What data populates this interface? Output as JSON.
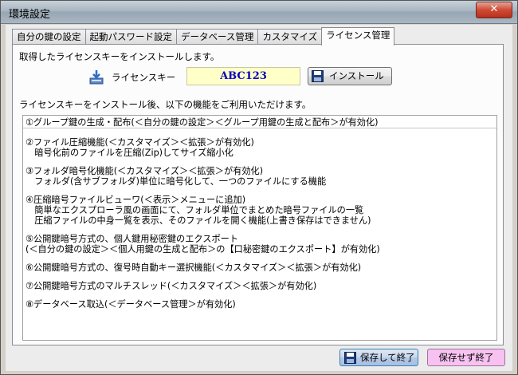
{
  "window": {
    "title": "環境設定",
    "close_glyph": "✕"
  },
  "tabs": [
    {
      "label": "自分の鍵の設定",
      "active": false
    },
    {
      "label": "起動パスワード設定",
      "active": false
    },
    {
      "label": "データベース管理",
      "active": false
    },
    {
      "label": "カスタマイズ",
      "active": false
    },
    {
      "label": "ライセンス管理",
      "active": true
    }
  ],
  "license": {
    "intro": "取得したライセンスキーをインストールします。",
    "key_label": "ライセンスキー",
    "key_value": "ABC123",
    "install_label": "インストール",
    "after_text": "ライセンスキーをインストール後、以下の機能をご利用いただけます。"
  },
  "features": [
    "①グループ鍵の生成・配布(＜自分の鍵の設定＞＜グループ用鍵の生成と配布＞が有効化)",
    "②ファイル圧縮機能(＜カスタマイズ＞＜拡張＞が有効化)\n　暗号化前のファイルを圧縮(Zip)してサイズ縮小化",
    "③フォルダ暗号化機能(＜カスタマイズ＞＜拡張＞が有効化)\n　フォルダ(含サブフォルダ)単位に暗号化して、一つのファイルにする機能",
    "④圧縮暗号ファイルビューワ(＜表示＞メニューに追加)\n　簡単なエクスプローラ風の画面にて、フォルダ単位でまとめた暗号ファイルの一覧\n　圧縮ファイルの中身一覧を表示、そのファイルを開く機能(上書き保存はできません)",
    "⑤公開鍵暗号方式の、個人鍵用秘密鍵のエクスポート\n(＜自分の鍵の設定＞＜個人用鍵の生成と配布＞の【口秘密鍵のエクスポート】が有効化)",
    "⑥公開鍵暗号方式の、復号時自動キー選択機能(＜カスタマイズ＞＜拡張＞が有効化)",
    "⑦公開鍵暗号方式のマルチスレッド(＜カスタマイズ＞＜拡張＞が有効化)",
    "⑧データベース取込(＜データベース管理＞が有効化)"
  ],
  "buttons": {
    "save_exit": "保存して終了",
    "exit_no_save": "保存せず終了"
  },
  "icons": {
    "install": "floppy-icon",
    "license": "install-download-icon",
    "save": "floppy-icon"
  }
}
